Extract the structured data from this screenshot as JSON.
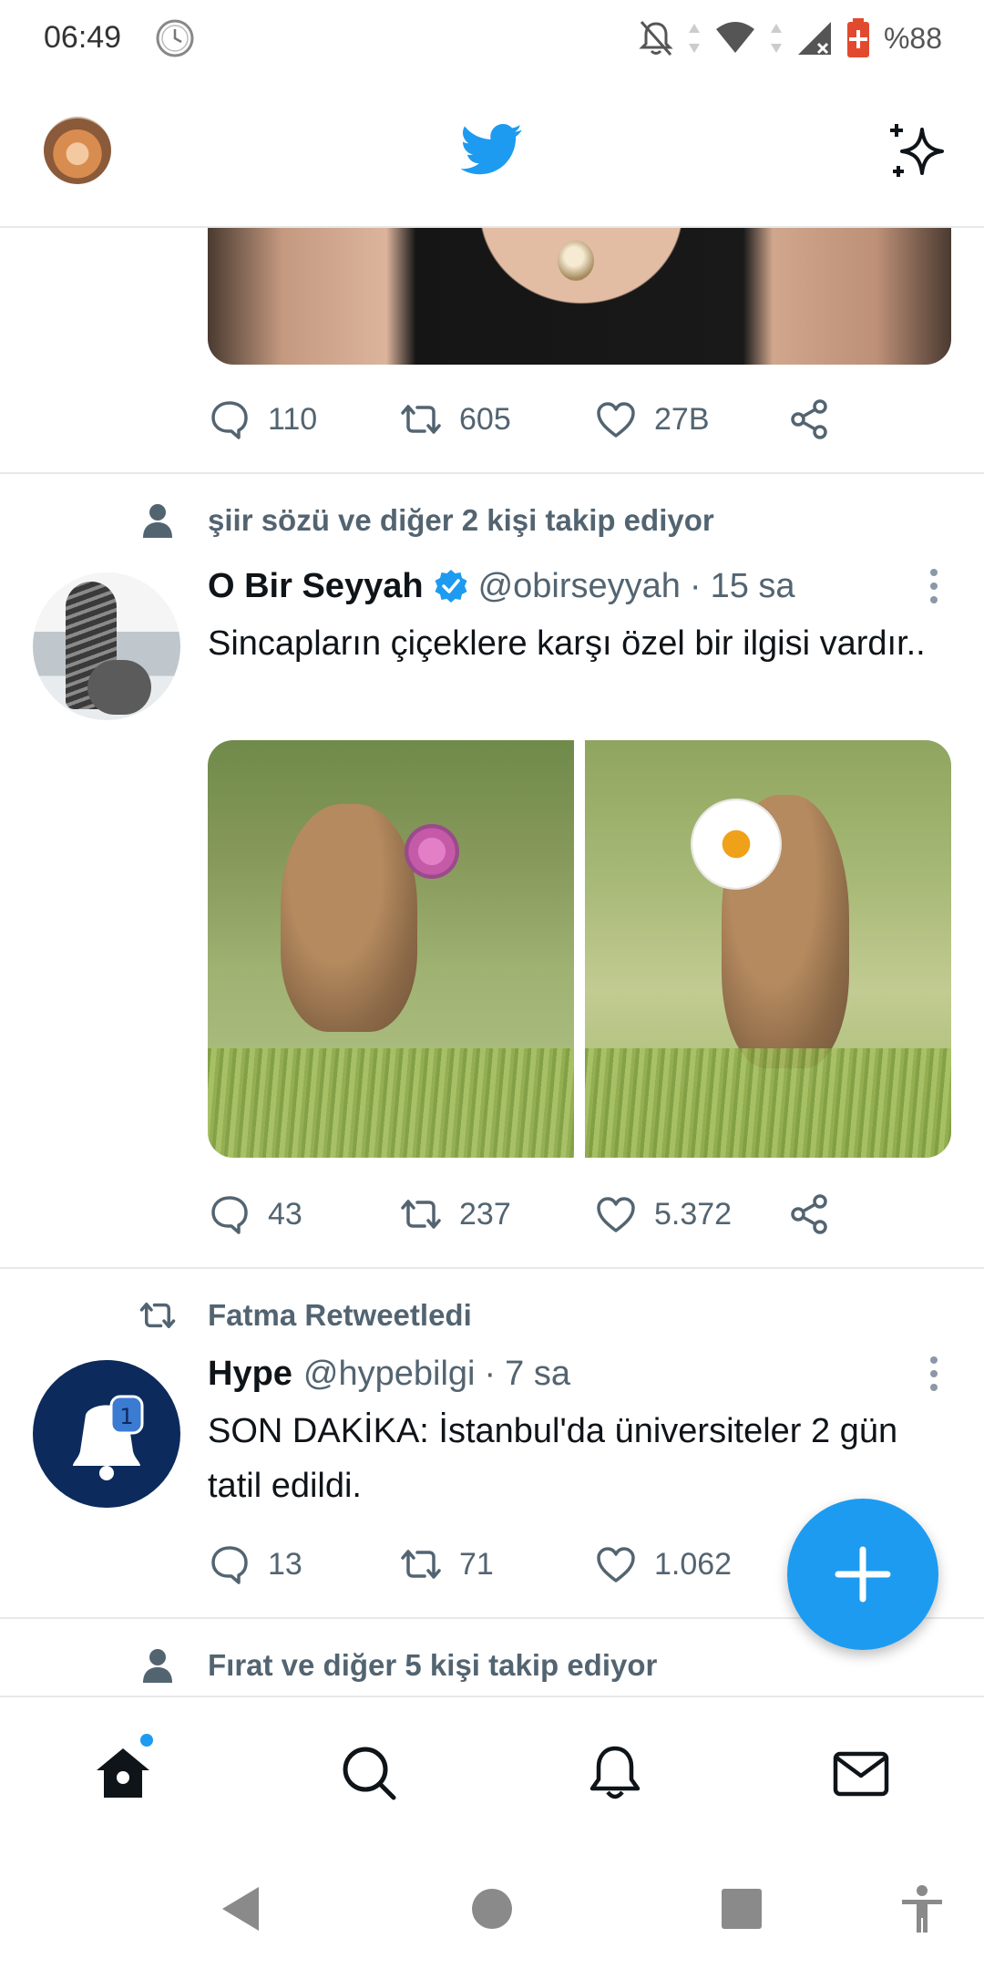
{
  "status_bar": {
    "time": "06:49",
    "battery_percent": "%88",
    "icons": [
      "clock-icon",
      "notifications-muted-icon",
      "data-arrows-icon",
      "wifi-icon",
      "signal-icon",
      "battery-icon"
    ]
  },
  "app_bar": {
    "logo": "twitter-bird-icon",
    "accent_color": "#1d9bf0"
  },
  "tweets": [
    {
      "stats": {
        "replies": "110",
        "retweets": "605",
        "likes": "27B"
      }
    },
    {
      "context": "şiir sözü ve diğer 2 kişi takip ediyor",
      "name": "O Bir Seyyah",
      "verified": true,
      "handle": "@obirseyyah",
      "separator": "·",
      "time": "15 sa",
      "text": "Sincapların çiçeklere karşı özel bir ilgisi vardır..",
      "stats": {
        "replies": "43",
        "retweets": "237",
        "likes": "5.372"
      }
    },
    {
      "context": "Fatma Retweetledi",
      "name": "Hype",
      "handle": "@hypebilgi",
      "separator": "·",
      "time": "7 sa",
      "text": "SON DAKİKA: İstanbul'da üniversiteler 2 gün tatil edildi.",
      "avatar_badge": "1",
      "stats": {
        "replies": "13",
        "retweets": "71",
        "likes": "1.062"
      }
    },
    {
      "context": "Fırat ve diğer 5 kişi takip ediyor"
    }
  ],
  "bottom_nav": {
    "items": [
      "home-icon",
      "search-icon",
      "notifications-icon",
      "messages-icon"
    ],
    "home_has_new": true
  }
}
